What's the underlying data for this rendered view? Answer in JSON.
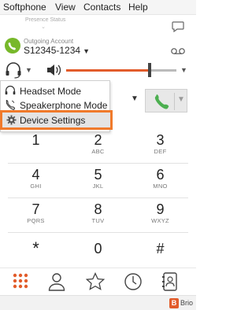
{
  "menubar": {
    "items": [
      "Softphone",
      "View",
      "Contacts",
      "Help"
    ]
  },
  "presence": {
    "label": "Presence Status"
  },
  "account": {
    "label": "Outgoing Account",
    "number": "S12345-1234"
  },
  "audio": {
    "volume_percent": 76
  },
  "dropdown": {
    "items": [
      "Headset Mode",
      "Speakerphone Mode"
    ],
    "settings_label": "Device Settings"
  },
  "keypad": [
    {
      "digit": "1",
      "letters": ""
    },
    {
      "digit": "2",
      "letters": "ABC"
    },
    {
      "digit": "3",
      "letters": "DEF"
    },
    {
      "digit": "4",
      "letters": "GHI"
    },
    {
      "digit": "5",
      "letters": "JKL"
    },
    {
      "digit": "6",
      "letters": "MNO"
    },
    {
      "digit": "7",
      "letters": "PQRS"
    },
    {
      "digit": "8",
      "letters": "TUV"
    },
    {
      "digit": "9",
      "letters": "WXYZ"
    },
    {
      "digit": "*",
      "letters": ""
    },
    {
      "digit": "0",
      "letters": ""
    },
    {
      "digit": "#",
      "letters": ""
    }
  ],
  "nav": [
    "dialpad-icon",
    "contacts-icon",
    "favorites-icon",
    "history-icon",
    "directory-icon"
  ],
  "brand": {
    "logo_letter": "B",
    "name": "Brio"
  },
  "colors": {
    "accent": "#e25c2b",
    "highlight": "#f07a2b",
    "call_green": "#4caf50",
    "account_green": "#77b82a"
  }
}
